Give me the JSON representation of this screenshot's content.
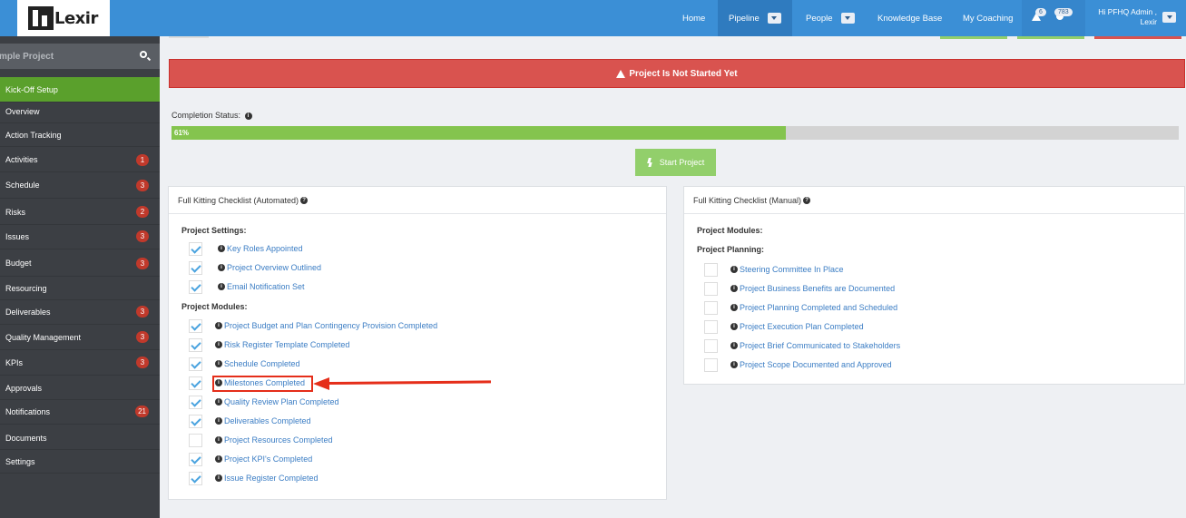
{
  "brand": {
    "logo_text": "Lexir"
  },
  "nav": {
    "home": "Home",
    "pipeline": "Pipeline",
    "people": "People",
    "knowledge_base": "Knowledge Base",
    "my_coaching": "My Coaching",
    "alerts_count": "6",
    "messages_count": "783",
    "user_greeting": "Hi PFHQ Admin ,",
    "user_org": "Lexir"
  },
  "sidebar": {
    "search_text": "mple Project",
    "items": [
      {
        "label": "Kick-Off Setup",
        "badge": ""
      },
      {
        "label": "Overview",
        "badge": ""
      },
      {
        "label": "Action Tracking",
        "badge": ""
      },
      {
        "label": "Activities",
        "badge": "1"
      },
      {
        "label": "Schedule",
        "badge": "3"
      },
      {
        "label": "Risks",
        "badge": "2"
      },
      {
        "label": "Issues",
        "badge": "3"
      },
      {
        "label": "Budget",
        "badge": "3"
      },
      {
        "label": "Resourcing",
        "badge": ""
      },
      {
        "label": "Deliverables",
        "badge": "3"
      },
      {
        "label": "Quality Management",
        "badge": "3"
      },
      {
        "label": "KPIs",
        "badge": "3"
      },
      {
        "label": "Approvals",
        "badge": ""
      },
      {
        "label": "Notifications",
        "badge": "21"
      },
      {
        "label": "Documents",
        "badge": ""
      },
      {
        "label": "Settings",
        "badge": ""
      }
    ]
  },
  "alert": {
    "text": "Project Is Not Started Yet"
  },
  "completion": {
    "label": "Completion Status:",
    "percent_text": "61%",
    "percent": 61
  },
  "start_button": {
    "label": "Start Project"
  },
  "automated": {
    "title": "Full Kitting Checklist (Automated)",
    "settings_heading": "Project Settings:",
    "settings": [
      {
        "label": "Key Roles Appointed",
        "checked": true
      },
      {
        "label": "Project Overview Outlined",
        "checked": true
      },
      {
        "label": "Email Notification Set",
        "checked": true
      }
    ],
    "modules_heading": "Project Modules:",
    "modules": [
      {
        "label": "Project Budget and Plan Contingency Provision Completed",
        "checked": true
      },
      {
        "label": "Risk Register Template Completed",
        "checked": true
      },
      {
        "label": "Schedule Completed",
        "checked": true
      },
      {
        "label": "Milestones Completed",
        "checked": true
      },
      {
        "label": "Quality Review Plan Completed",
        "checked": true
      },
      {
        "label": "Deliverables Completed",
        "checked": true
      },
      {
        "label": "Project Resources Completed",
        "checked": false
      },
      {
        "label": "Project KPI's Completed",
        "checked": true
      },
      {
        "label": "Issue Register Completed",
        "checked": true
      }
    ]
  },
  "manual": {
    "title": "Full Kitting Checklist (Manual)",
    "modules_heading": "Project Modules:",
    "planning_heading": "Project Planning:",
    "planning": [
      {
        "label": "Steering Committee In Place",
        "checked": false
      },
      {
        "label": "Project Business Benefits are Documented",
        "checked": false
      },
      {
        "label": "Project Planning Completed and Scheduled",
        "checked": false
      },
      {
        "label": "Project Execution Plan Completed",
        "checked": false
      },
      {
        "label": "Project Brief Communicated to Stakeholders",
        "checked": false
      },
      {
        "label": "Project Scope Documented and Approved",
        "checked": false
      }
    ]
  },
  "colors": {
    "navbar": "#3b8fd6",
    "sidebar": "#3c3f44",
    "sidebar_active": "#5aa02c",
    "alert": "#d9534f",
    "progress": "#84c44e",
    "badge": "#c0392b",
    "annotation": "#e52e1a"
  }
}
